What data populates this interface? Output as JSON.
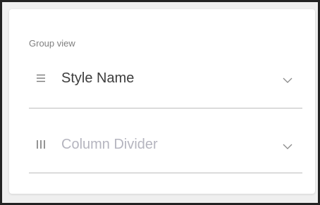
{
  "panel": {
    "group_label": "Group view",
    "rows": [
      {
        "label": "Style Name",
        "icon": "hamburger-icon",
        "state": "selected"
      },
      {
        "label": "Column Divider",
        "icon": "column-bars-icon",
        "state": "placeholder"
      }
    ]
  },
  "colors": {
    "label_primary": "#3d3d3d",
    "label_placeholder": "#b5b5bf",
    "group_label": "#7f7f7f",
    "divider": "#bdbdbd",
    "icon": "#7a7a7a",
    "card_background": "#ffffff"
  }
}
